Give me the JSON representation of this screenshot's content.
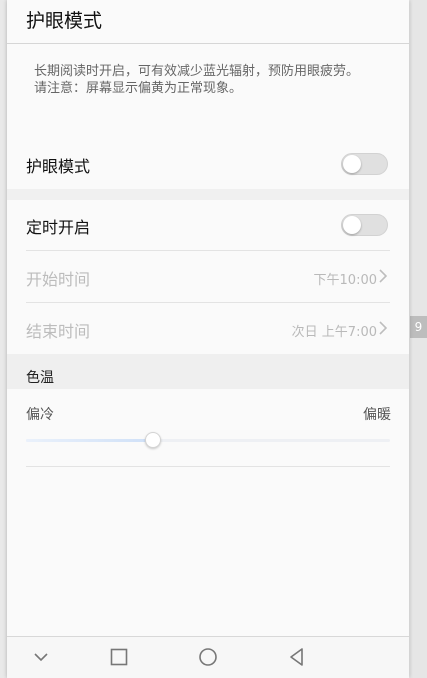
{
  "header": {
    "title": "护眼模式"
  },
  "description": {
    "line1": "长期阅读时开启，可有效减少蓝光辐射，预防用眼疲劳。",
    "line2": "请注意：屏幕显示偏黄为正常现象。"
  },
  "eye_comfort": {
    "label": "护眼模式",
    "enabled": false
  },
  "schedule": {
    "label": "定时开启",
    "enabled": false,
    "start": {
      "label": "开始时间",
      "value": "下午10:00"
    },
    "end": {
      "label": "结束时间",
      "value": "次日 上午7:00"
    }
  },
  "color_temp": {
    "heading": "色温",
    "cool_label": "偏冷",
    "warm_label": "偏暖",
    "level": 0.35
  },
  "background": {
    "peek_number": "9"
  },
  "navbar": {
    "icons": [
      "chevron-down-icon",
      "square-icon",
      "circle-icon",
      "triangle-back-icon"
    ]
  }
}
